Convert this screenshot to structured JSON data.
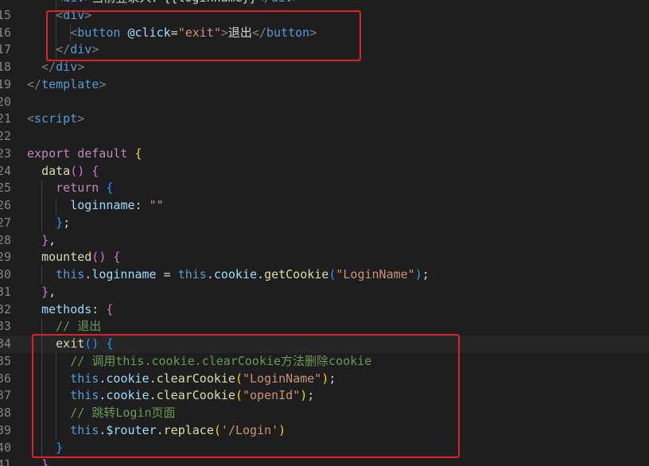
{
  "lines": [
    {
      "num": "",
      "indent": 2,
      "guides": [
        2
      ],
      "tokens": [
        {
          "t": "<",
          "c": "tk-punc"
        },
        {
          "t": "div",
          "c": "tk-tag"
        },
        {
          "t": ">",
          "c": "tk-punc"
        },
        {
          "t": "当前登录人：{{loginname}}",
          "c": "tk-txt"
        },
        {
          "t": "</",
          "c": "tk-punc"
        },
        {
          "t": "div",
          "c": "tk-tag"
        },
        {
          "t": ">",
          "c": "tk-punc"
        }
      ]
    },
    {
      "num": "15",
      "indent": 2,
      "guides": [
        2
      ],
      "tokens": [
        {
          "t": "<",
          "c": "tk-punc"
        },
        {
          "t": "div",
          "c": "tk-tag"
        },
        {
          "t": ">",
          "c": "tk-punc"
        }
      ]
    },
    {
      "num": "16",
      "indent": 3,
      "guides": [
        2,
        3
      ],
      "tokens": [
        {
          "t": "<",
          "c": "tk-punc"
        },
        {
          "t": "button",
          "c": "tk-tag"
        },
        {
          "t": " ",
          "c": "tk-txt"
        },
        {
          "t": "@click",
          "c": "tk-attr"
        },
        {
          "t": "=",
          "c": "tk-txt"
        },
        {
          "t": "\"exit\"",
          "c": "tk-str"
        },
        {
          "t": ">",
          "c": "tk-punc"
        },
        {
          "t": "退出",
          "c": "tk-txt"
        },
        {
          "t": "</",
          "c": "tk-punc"
        },
        {
          "t": "button",
          "c": "tk-tag"
        },
        {
          "t": ">",
          "c": "tk-punc"
        }
      ]
    },
    {
      "num": "17",
      "indent": 2,
      "guides": [
        2
      ],
      "tokens": [
        {
          "t": "</",
          "c": "tk-punc"
        },
        {
          "t": "div",
          "c": "tk-tag"
        },
        {
          "t": ">",
          "c": "tk-punc"
        }
      ]
    },
    {
      "num": "18",
      "indent": 1,
      "guides": [],
      "tokens": [
        {
          "t": "</",
          "c": "tk-punc"
        },
        {
          "t": "div",
          "c": "tk-tag"
        },
        {
          "t": ">",
          "c": "tk-punc"
        }
      ]
    },
    {
      "num": "19",
      "indent": 0,
      "guides": [],
      "tokens": [
        {
          "t": "</",
          "c": "tk-punc"
        },
        {
          "t": "template",
          "c": "tk-tag"
        },
        {
          "t": ">",
          "c": "tk-punc"
        }
      ]
    },
    {
      "num": "20",
      "indent": 0,
      "guides": [],
      "tokens": []
    },
    {
      "num": "21",
      "indent": 0,
      "guides": [],
      "tokens": [
        {
          "t": "<",
          "c": "tk-punc"
        },
        {
          "t": "script",
          "c": "tk-tag"
        },
        {
          "t": ">",
          "c": "tk-punc"
        }
      ]
    },
    {
      "num": "22",
      "indent": 0,
      "guides": [],
      "tokens": []
    },
    {
      "num": "23",
      "indent": 0,
      "guides": [],
      "tokens": [
        {
          "t": "export",
          "c": "tk-kw"
        },
        {
          "t": " ",
          "c": "tk-txt"
        },
        {
          "t": "default",
          "c": "tk-kw"
        },
        {
          "t": " ",
          "c": "tk-txt"
        },
        {
          "t": "{",
          "c": "tk-br1"
        }
      ]
    },
    {
      "num": "24",
      "indent": 1,
      "guides": [],
      "tokens": [
        {
          "t": "data",
          "c": "tk-fn"
        },
        {
          "t": "()",
          "c": "tk-br2"
        },
        {
          "t": " ",
          "c": "tk-txt"
        },
        {
          "t": "{",
          "c": "tk-br2"
        }
      ]
    },
    {
      "num": "25",
      "indent": 2,
      "guides": [
        1
      ],
      "tokens": [
        {
          "t": "return",
          "c": "tk-kw"
        },
        {
          "t": " ",
          "c": "tk-txt"
        },
        {
          "t": "{",
          "c": "tk-br3"
        }
      ]
    },
    {
      "num": "26",
      "indent": 3,
      "guides": [
        1,
        2
      ],
      "tokens": [
        {
          "t": "loginname",
          "c": "tk-prop"
        },
        {
          "t": ": ",
          "c": "tk-txt"
        },
        {
          "t": "\"\"",
          "c": "tk-str"
        }
      ]
    },
    {
      "num": "27",
      "indent": 2,
      "guides": [
        1
      ],
      "tokens": [
        {
          "t": "}",
          "c": "tk-br3"
        },
        {
          "t": ";",
          "c": "tk-txt"
        }
      ]
    },
    {
      "num": "28",
      "indent": 1,
      "guides": [],
      "tokens": [
        {
          "t": "}",
          "c": "tk-br2"
        },
        {
          "t": ",",
          "c": "tk-txt"
        }
      ]
    },
    {
      "num": "29",
      "indent": 1,
      "guides": [],
      "tokens": [
        {
          "t": "mounted",
          "c": "tk-fn"
        },
        {
          "t": "()",
          "c": "tk-br2"
        },
        {
          "t": " ",
          "c": "tk-txt"
        },
        {
          "t": "{",
          "c": "tk-br2"
        }
      ]
    },
    {
      "num": "30",
      "indent": 2,
      "guides": [
        1
      ],
      "tokens": [
        {
          "t": "this",
          "c": "tk-this"
        },
        {
          "t": ".",
          "c": "tk-txt"
        },
        {
          "t": "loginname",
          "c": "tk-prop"
        },
        {
          "t": " = ",
          "c": "tk-txt"
        },
        {
          "t": "this",
          "c": "tk-this"
        },
        {
          "t": ".",
          "c": "tk-txt"
        },
        {
          "t": "cookie",
          "c": "tk-prop"
        },
        {
          "t": ".",
          "c": "tk-txt"
        },
        {
          "t": "getCookie",
          "c": "tk-fn"
        },
        {
          "t": "(",
          "c": "tk-br3"
        },
        {
          "t": "\"LoginName\"",
          "c": "tk-str"
        },
        {
          "t": ")",
          "c": "tk-br3"
        },
        {
          "t": ";",
          "c": "tk-txt"
        }
      ]
    },
    {
      "num": "31",
      "indent": 1,
      "guides": [],
      "tokens": [
        {
          "t": "}",
          "c": "tk-br2"
        },
        {
          "t": ",",
          "c": "tk-txt"
        }
      ]
    },
    {
      "num": "32",
      "indent": 1,
      "guides": [],
      "tokens": [
        {
          "t": "methods",
          "c": "tk-prop"
        },
        {
          "t": ": ",
          "c": "tk-txt"
        },
        {
          "t": "{",
          "c": "tk-br2"
        }
      ]
    },
    {
      "num": "33",
      "indent": 2,
      "guides": [
        1
      ],
      "tokens": [
        {
          "t": "// 退出",
          "c": "tk-cm"
        }
      ]
    },
    {
      "num": "34",
      "indent": 2,
      "guides": [
        1
      ],
      "current": true,
      "tokens": [
        {
          "t": "exit",
          "c": "tk-fn"
        },
        {
          "t": "()",
          "c": "tk-br3"
        },
        {
          "t": " ",
          "c": "tk-txt"
        },
        {
          "t": "{",
          "c": "tk-br3"
        }
      ]
    },
    {
      "num": "35",
      "indent": 3,
      "guides": [
        1,
        2
      ],
      "tokens": [
        {
          "t": "// 调用this.cookie.clearCookie方法删除cookie",
          "c": "tk-cm"
        }
      ]
    },
    {
      "num": "36",
      "indent": 3,
      "guides": [
        1,
        2
      ],
      "tokens": [
        {
          "t": "this",
          "c": "tk-this"
        },
        {
          "t": ".",
          "c": "tk-txt"
        },
        {
          "t": "cookie",
          "c": "tk-prop"
        },
        {
          "t": ".",
          "c": "tk-txt"
        },
        {
          "t": "clearCookie",
          "c": "tk-fn"
        },
        {
          "t": "(",
          "c": "tk-br1"
        },
        {
          "t": "\"LoginName\"",
          "c": "tk-str"
        },
        {
          "t": ")",
          "c": "tk-br1"
        },
        {
          "t": ";",
          "c": "tk-txt"
        }
      ]
    },
    {
      "num": "37",
      "indent": 3,
      "guides": [
        1,
        2
      ],
      "tokens": [
        {
          "t": "this",
          "c": "tk-this"
        },
        {
          "t": ".",
          "c": "tk-txt"
        },
        {
          "t": "cookie",
          "c": "tk-prop"
        },
        {
          "t": ".",
          "c": "tk-txt"
        },
        {
          "t": "clearCookie",
          "c": "tk-fn"
        },
        {
          "t": "(",
          "c": "tk-br1"
        },
        {
          "t": "\"openId\"",
          "c": "tk-str"
        },
        {
          "t": ")",
          "c": "tk-br1"
        },
        {
          "t": ";",
          "c": "tk-txt"
        }
      ]
    },
    {
      "num": "38",
      "indent": 3,
      "guides": [
        1,
        2
      ],
      "tokens": [
        {
          "t": "// 跳转Login页面",
          "c": "tk-cm"
        }
      ]
    },
    {
      "num": "39",
      "indent": 3,
      "guides": [
        1,
        2
      ],
      "tokens": [
        {
          "t": "this",
          "c": "tk-this"
        },
        {
          "t": ".",
          "c": "tk-txt"
        },
        {
          "t": "$router",
          "c": "tk-prop"
        },
        {
          "t": ".",
          "c": "tk-txt"
        },
        {
          "t": "replace",
          "c": "tk-fn"
        },
        {
          "t": "(",
          "c": "tk-br1"
        },
        {
          "t": "'/Login'",
          "c": "tk-str"
        },
        {
          "t": ")",
          "c": "tk-br1"
        }
      ]
    },
    {
      "num": "40",
      "indent": 2,
      "guides": [
        1
      ],
      "tokens": [
        {
          "t": "}",
          "c": "tk-br3"
        }
      ]
    },
    {
      "num": "41",
      "indent": 1,
      "guides": [],
      "tokens": [
        {
          "t": "}",
          "c": "tk-br2"
        }
      ]
    }
  ]
}
